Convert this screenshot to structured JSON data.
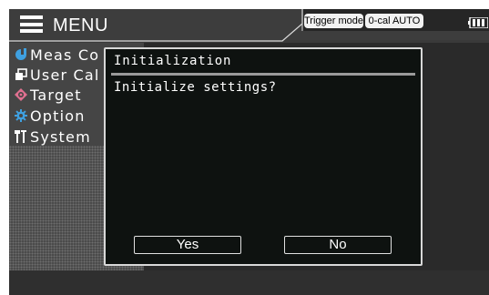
{
  "header": {
    "menu_label": "MENU",
    "trigger_mode_label": "Trigger mode",
    "zero_cal_label": "0-cal AUTO"
  },
  "sidebar": {
    "items": [
      {
        "label": "Meas Co",
        "icon": "meas-conditions-icon"
      },
      {
        "label": "User Cal",
        "icon": "user-cal-icon"
      },
      {
        "label": "Target",
        "icon": "target-icon"
      },
      {
        "label": "Option",
        "icon": "gear-icon"
      },
      {
        "label": "System",
        "icon": "tools-icon"
      }
    ]
  },
  "dialog": {
    "title": "Initialization",
    "message": "Initialize settings?",
    "yes_label": "Yes",
    "no_label": "No"
  },
  "colors": {
    "screen_bg": "#3a3a3a",
    "dialog_bg": "#0e1210",
    "accent_blue": "#3fa0e0",
    "target_pink": "#e07090"
  }
}
